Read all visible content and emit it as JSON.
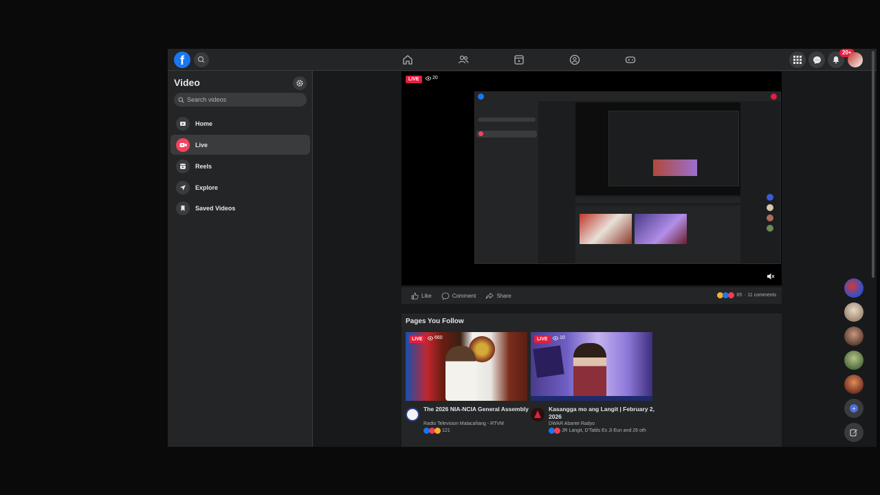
{
  "topbar": {
    "logo_letter": "f",
    "notification_badge": "20+",
    "nav_icons": [
      "home-icon",
      "friends-icon",
      "watch-icon",
      "groups-icon",
      "gaming-icon"
    ],
    "right_icons": [
      "menu-grid-icon",
      "messenger-icon",
      "bell-icon"
    ]
  },
  "sidebar": {
    "title": "Video",
    "search_placeholder": "Search videos",
    "items": [
      {
        "label": "Home",
        "icon": "video-home-icon",
        "active": false
      },
      {
        "label": "Live",
        "icon": "live-icon",
        "active": true
      },
      {
        "label": "Reels",
        "icon": "reels-icon",
        "active": false
      },
      {
        "label": "Explore",
        "icon": "explore-icon",
        "active": false
      },
      {
        "label": "Saved Videos",
        "icon": "bookmark-icon",
        "active": false
      }
    ]
  },
  "player": {
    "live_label": "LIVE",
    "viewer_count": "20"
  },
  "actions": {
    "like": "Like",
    "comment": "Comment",
    "share": "Share",
    "reaction_count": "65",
    "comments": "11 comments"
  },
  "pages_you_follow": {
    "title": "Pages You Follow",
    "cards": [
      {
        "live_label": "LIVE",
        "viewers": "660",
        "title": "The 2026 NIA-NCIA General Assembly",
        "page": "Radio Television Malacañang - RTVM",
        "reactions": "121"
      },
      {
        "live_label": "LIVE",
        "viewers": "10",
        "title": "Kasangga mo ang Langit | February 2, 2026",
        "page": "DWAR Abante Radyo",
        "reactions": "JR Langit, D'Talds Es Ji Eun and 26 oth"
      }
    ]
  },
  "colors": {
    "brand": "#1877f2",
    "live": "#e41e3f",
    "surface": "#242526",
    "background": "#18191a"
  }
}
